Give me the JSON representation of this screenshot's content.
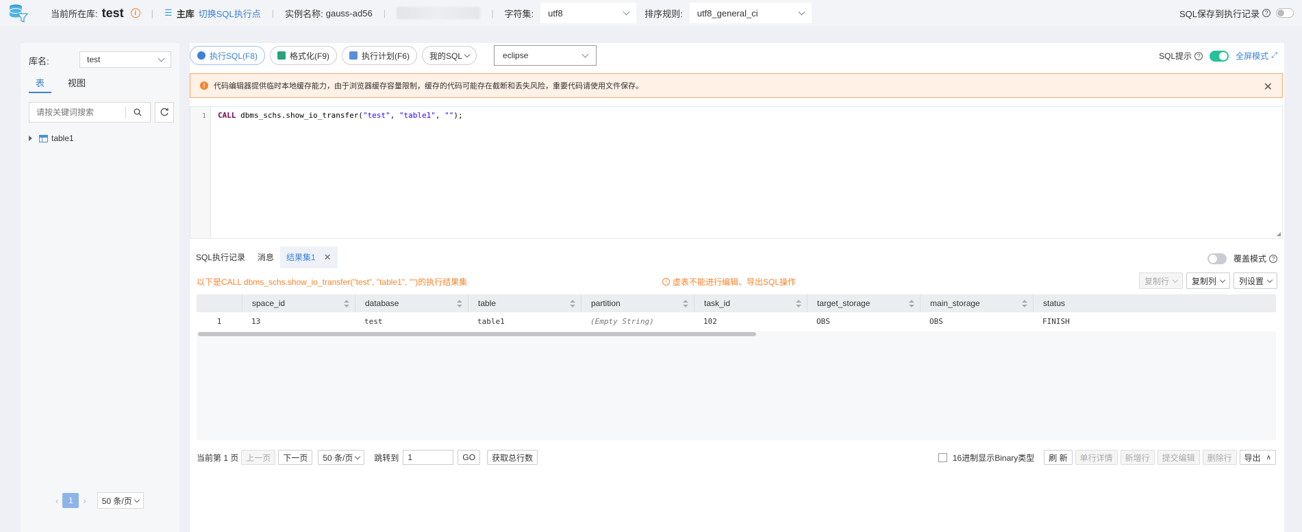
{
  "topbar": {
    "current_db_label": "当前所在库:",
    "current_db": "test",
    "main_label": "主库",
    "switch_link": "切换SQL执行点",
    "instance_label": "实例名称:",
    "instance_name": "gauss-ad56",
    "charset_label": "字符集:",
    "charset_value": "utf8",
    "collation_label": "排序规则:",
    "collation_value": "utf8_general_ci",
    "save_history_label": "SQL保存到执行记录"
  },
  "left": {
    "db_label": "库名:",
    "db_value": "test",
    "tabs": [
      {
        "label": "表",
        "active": true
      },
      {
        "label": "视图",
        "active": false
      }
    ],
    "search_placeholder": "请按关键词搜索",
    "tree": [
      {
        "label": "table1"
      }
    ],
    "pager": {
      "current": "1",
      "per_page": "50 条/页"
    }
  },
  "toolbar": {
    "run": "执行SQL(F8)",
    "format": "格式化(F9)",
    "plan": "执行计划(F6)",
    "my_sql": "我的SQL",
    "theme": "eclipse",
    "sql_hint": "SQL提示",
    "fullscreen": "全屏模式"
  },
  "alert": {
    "text": "代码编辑器提供临时本地缓存能力，由于浏览器缓存容量限制，缓存的代码可能存在截断和丢失风险，重要代码请使用文件保存。"
  },
  "editor": {
    "line": "1"
  },
  "result": {
    "tabs": [
      {
        "label": "SQL执行记录"
      },
      {
        "label": "消息"
      },
      {
        "label": "结果集1",
        "active": true
      }
    ],
    "cover_mode": "覆盖模式",
    "title": "以下是CALL dbms_schs.show_io_transfer(\"test\", \"table1\", \"\")的执行结果集",
    "warning": "虚表不能进行编辑、导出SQL操作",
    "buttons": {
      "copy_row": "复制行",
      "copy_col": "复制列",
      "col_settings": "列设置"
    },
    "columns": [
      "",
      "space_id",
      "database",
      "table",
      "partition",
      "task_id",
      "target_storage",
      "main_storage",
      "status"
    ],
    "rows": [
      [
        "1",
        "13",
        "test",
        "table1",
        "(Empty String)",
        "102",
        "OBS",
        "OBS",
        "FINISH"
      ]
    ]
  },
  "footer": {
    "page_info": "当前第 1 页",
    "prev": "上一页",
    "next": "下一页",
    "per_page": "50 条/页",
    "jump_label": "跳转到",
    "jump_value": "1",
    "go": "GO",
    "total": "获取总行数",
    "hex_binary": "16进制显示Binary类型",
    "refresh": "刷 新",
    "row_detail": "单行详情",
    "new_row": "新增行",
    "submit_edit": "提交编辑",
    "delete_row": "删除行",
    "export": "导出"
  },
  "colors": {
    "accent": "#3b82d8",
    "warning": "#f5842d",
    "toggle_on": "#26c29a"
  }
}
